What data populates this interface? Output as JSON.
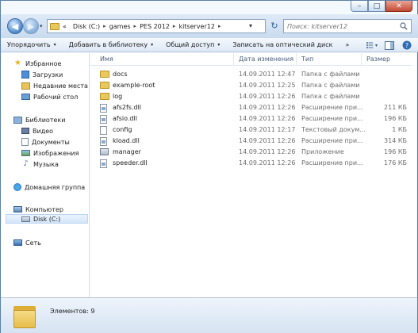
{
  "window": {
    "caption": {
      "minimize": "–",
      "maximize": "□",
      "close": "✕"
    }
  },
  "address": {
    "recent_glyph": "▾",
    "lead": "«",
    "crumbs": [
      "Disk (C:)",
      "games",
      "PES 2012",
      "kitserver12"
    ],
    "separator": "▸",
    "dropdown": "▾",
    "refresh": "↻"
  },
  "search": {
    "placeholder": "Поиск: kitserver12"
  },
  "toolbar": {
    "organize": "Упорядочить",
    "add_to_library": "Добавить в библиотеку",
    "share": "Общий доступ",
    "burn": "Записать на оптический диск",
    "more": "»",
    "arrow": "▾"
  },
  "navigation": {
    "favorites": "Избранное",
    "downloads": "Загрузки",
    "recent": "Недавние места",
    "desktop": "Рабочий стол",
    "libraries": "Библиотеки",
    "video": "Видео",
    "documents": "Документы",
    "images": "Изображения",
    "music": "Музыка",
    "homegroup": "Домашняя группа",
    "computer": "Компьютер",
    "disk": "Disk (C:)",
    "network": "Сеть"
  },
  "columns": {
    "name": "Имя",
    "date": "Дата изменения",
    "type": "Тип",
    "size": "Размер"
  },
  "files": [
    {
      "name": "docs",
      "date": "14.09.2011 12:47",
      "type": "Папка с файлами",
      "size": "",
      "kind": "folder"
    },
    {
      "name": "example-root",
      "date": "14.09.2011 12:25",
      "type": "Папка с файлами",
      "size": "",
      "kind": "folder"
    },
    {
      "name": "log",
      "date": "14.09.2011 12:26",
      "type": "Папка с файлами",
      "size": "",
      "kind": "folder"
    },
    {
      "name": "afs2fs.dll",
      "date": "14.09.2011 12:26",
      "type": "Расширение при...",
      "size": "211 КБ",
      "kind": "dll"
    },
    {
      "name": "afsio.dll",
      "date": "14.09.2011 12:26",
      "type": "Расширение при...",
      "size": "196 КБ",
      "kind": "dll"
    },
    {
      "name": "config",
      "date": "14.09.2011 12:17",
      "type": "Текстовый докум...",
      "size": "1 КБ",
      "kind": "txt"
    },
    {
      "name": "kload.dll",
      "date": "14.09.2011 12:26",
      "type": "Расширение при...",
      "size": "314 КБ",
      "kind": "dll"
    },
    {
      "name": "manager",
      "date": "14.09.2011 12:26",
      "type": "Приложение",
      "size": "196 КБ",
      "kind": "exe"
    },
    {
      "name": "speeder.dll",
      "date": "14.09.2011 12:26",
      "type": "Расширение при...",
      "size": "176 КБ",
      "kind": "dll"
    }
  ],
  "status": {
    "count": "Элементов: 9"
  },
  "colors": {
    "accent": "#2f5f99",
    "selection": "#d4e6f9",
    "folder": "#e9c85c"
  }
}
